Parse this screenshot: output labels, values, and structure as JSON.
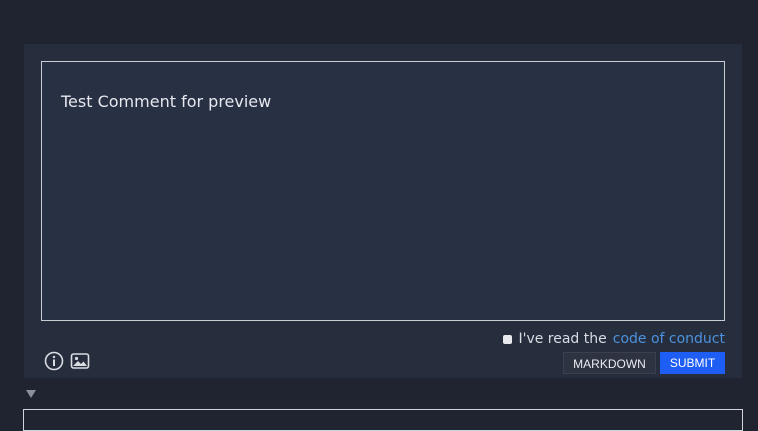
{
  "comment": {
    "text": "Test Comment for preview"
  },
  "code_of_conduct": {
    "prefix": "I've read the",
    "link_label": "code of conduct",
    "checked": false
  },
  "toolbar": {
    "info_icon": "info-icon",
    "image_icon": "image-icon",
    "markdown_label": "MARKDOWN",
    "submit_label": "SUBMIT"
  },
  "colors": {
    "background": "#1f2430",
    "panel": "#262d3d",
    "link": "#4b93de",
    "submit": "#1f5ef5"
  }
}
